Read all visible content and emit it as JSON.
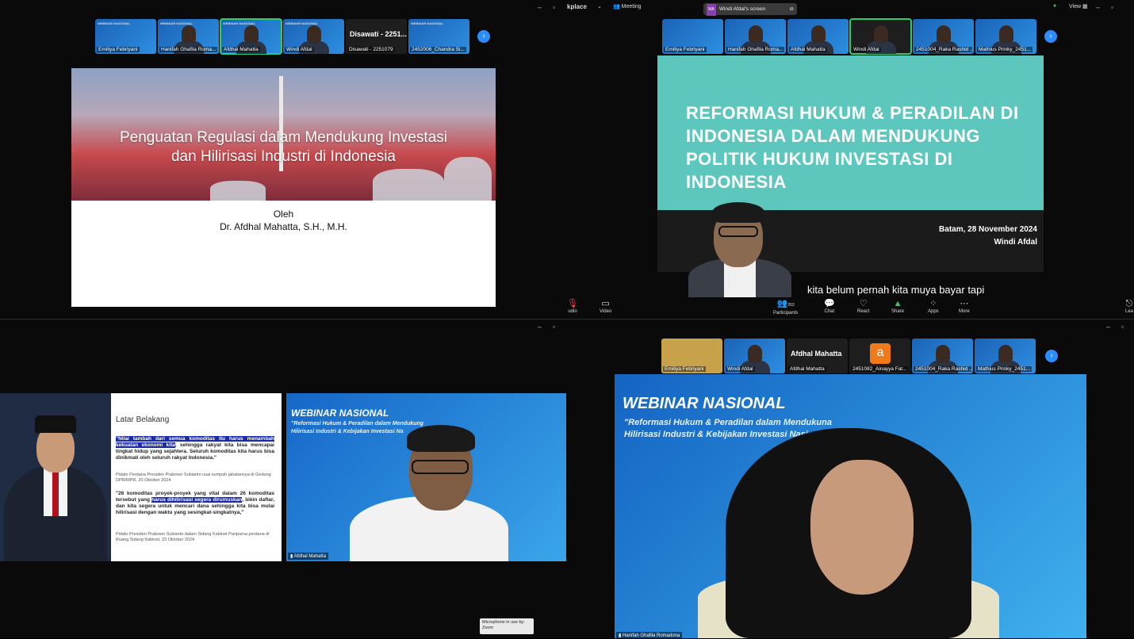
{
  "q1": {
    "thumbs": [
      {
        "name": "Emiliya Febriyani",
        "mini": "WEBINAR NASIONAL"
      },
      {
        "name": "Hanifah Ghafila Roma...",
        "mini": "WEBINAR NASIONAL"
      },
      {
        "name": "Afdhal Mahatta",
        "mini": "WEBINAR NASIONAL"
      },
      {
        "name": "Windi Afdal",
        "mini": "WEBINAR NASIONAL"
      },
      {
        "name": "Disawati - 2251079",
        "big": "Disawati - 2251..."
      },
      {
        "name": "2452006_Chandra Si...",
        "mini": "WEBINAR NASIONAL"
      }
    ],
    "slide": {
      "title": "Penguatan Regulasi dalam Mendukung Investasi dan Hilirisasi Industri di Indonesia",
      "by": "Oleh",
      "author": "Dr. Afdhal Mahatta, S.H., M.H."
    }
  },
  "q2": {
    "app_label": "kplace",
    "meeting_label": "Meeting",
    "share_badge": "WA",
    "share_label": "Windi Afdal's screen",
    "view_label": "View",
    "thumbs": [
      {
        "name": "Emiliya Febriyani"
      },
      {
        "name": "Hanifah Ghafila Roma..."
      },
      {
        "name": "Afdhal Mahatta"
      },
      {
        "name": "Windi Afdal"
      },
      {
        "name": "2451004_Raka Rashid ..."
      },
      {
        "name": "Mathius Prinky_2451..."
      }
    ],
    "slide": {
      "title": "REFORMASI HUKUM & PERADILAN DI INDONESIA DALAM MENDUKUNG POLITIK HUKUM INVESTASI DI INDONESIA",
      "date": "Batam, 28 November 2024",
      "presenter": "Windi Afdal"
    },
    "caption": "kita belum pernah kita muya bayar tapi",
    "toolbar": {
      "audio": "udio",
      "video": "Video",
      "participants": "Participants",
      "participants_count": "263",
      "chat": "Chat",
      "react": "React",
      "share": "Share",
      "apps": "Apps",
      "more": "More",
      "leave": "Lea"
    }
  },
  "q3": {
    "slide": {
      "heading": "Latar Belakang",
      "quote1_hl": "\"Nilai tambah dari semua komoditas itu harus menambah kekuatan ekonomi kita",
      "quote1_rest": ", sehingga rakyat kita bisa mencapai tingkat hidup yang sejahtera. Seluruh komoditas kita harus bisa dinikmati oleh seluruh rakyat Indonesia.\"",
      "source1": "Pidato Perdana Presiden Prabowo Subianto usai sumpah jabatannya di Gedung DPR/MPR, 20 Oktober 2024",
      "quote2_start": "\"26 komoditas proyek-proyek yang vital dalam 26 komoditas tersebut yang ",
      "quote2_hl": "harus dihilirisasi segera dirumuskan",
      "quote2_rest": ", bikin daftar, dan kita segera untuk mencari dana sehingga kita bisa mulai hilirisasi dengan waktu yang sesingkat-singkatnya,\"",
      "source2": "Pidato Presiden Prabowo Subianto dalam Sidang Kabinet Paripurna perdana di Ruang Sidang Kabinet, 23 Oktober 2024"
    },
    "video": {
      "title": "WEBINAR NASIONAL",
      "subtitle_1": "\"Reformasi Hukum & Peradilan dalam Mendukung",
      "subtitle_2": "Hilirisasi Industri & Kebijakan Investasi Na",
      "name": "Afdhal Mahatta"
    },
    "tooltip": "Microphone in use by: Zoom"
  },
  "q4": {
    "thumbs": [
      {
        "name": "Emiliya Febriyani"
      },
      {
        "name": "Windi Afdal"
      },
      {
        "name": "Afdhal Mahatta",
        "big": "Afdhal Mahatta"
      },
      {
        "name": "2451082_Ainayya Fat...",
        "avatar": "a"
      },
      {
        "name": "2451004_Raka Rashid ..."
      },
      {
        "name": "Mathius Prinky_2451..."
      }
    ],
    "video": {
      "title": "WEBINAR NASIONAL",
      "subtitle_1": "\"Reformasi Hukum & Peradilan dalam Mendukuna",
      "subtitle_2": "Hilirisasi Industri & Kebijakan Investasi Nasio",
      "name": "Hanifah Ghafila Romadona"
    }
  },
  "colors": {
    "accent": "#2d8cff",
    "active": "#2ecc71",
    "slide_teal": "#5ec7bd",
    "highlight": "#1a2aa8"
  }
}
